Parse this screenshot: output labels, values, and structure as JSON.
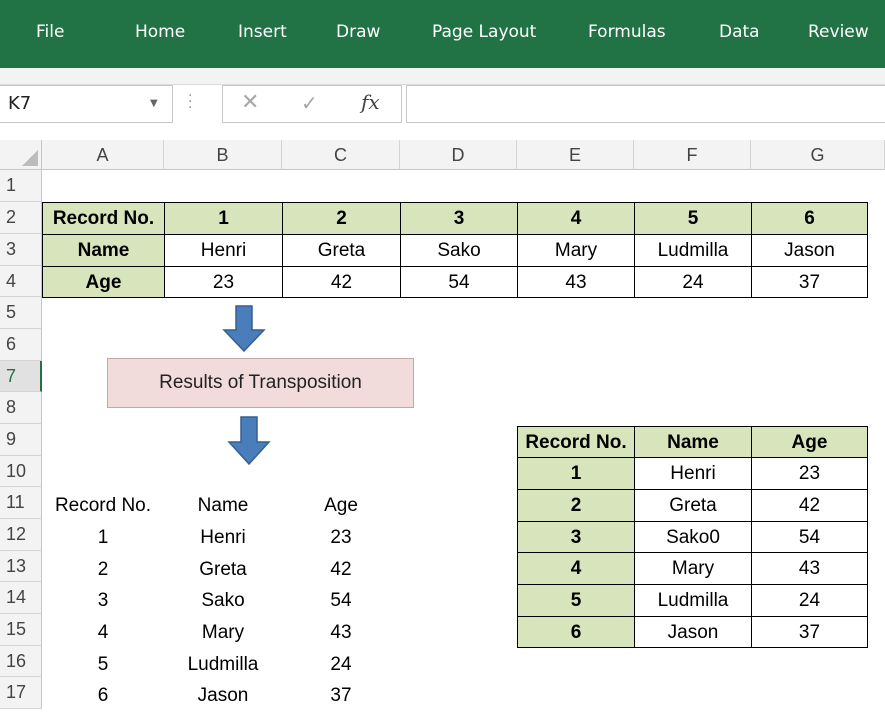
{
  "ribbon": {
    "tabs": [
      "File",
      "Home",
      "Insert",
      "Draw",
      "Page Layout",
      "Formulas",
      "Data",
      "Review"
    ],
    "color": "#217346"
  },
  "formula_bar": {
    "name_box": "K7",
    "cancel_icon": "close-icon",
    "enter_icon": "check-icon",
    "fx_label": "fx",
    "formula": ""
  },
  "sheet": {
    "columns": [
      "A",
      "B",
      "C",
      "D",
      "E",
      "F",
      "G"
    ],
    "rows": [
      "1",
      "2",
      "3",
      "4",
      "5",
      "6",
      "7",
      "8",
      "9",
      "10",
      "11",
      "12",
      "13",
      "14",
      "15",
      "16",
      "17"
    ],
    "selected_row": "7",
    "header_fill": "#d8e4bc"
  },
  "source_table": {
    "header_labels": [
      "Record No.",
      "Name",
      "Age"
    ],
    "record_nos": [
      "1",
      "2",
      "3",
      "4",
      "5",
      "6"
    ],
    "names": [
      "Henri",
      "Greta",
      "Sako",
      "Mary",
      "Ludmilla",
      "Jason"
    ],
    "ages": [
      "23",
      "42",
      "54",
      "43",
      "24",
      "37"
    ]
  },
  "results_label": "Results of Transposition",
  "result_plain": {
    "headers": [
      "Record No.",
      "Name",
      "Age"
    ],
    "rows": [
      [
        "1",
        "Henri",
        "23"
      ],
      [
        "2",
        "Greta",
        "42"
      ],
      [
        "3",
        "Sako",
        "54"
      ],
      [
        "4",
        "Mary",
        "43"
      ],
      [
        "5",
        "Ludmilla",
        "24"
      ],
      [
        "6",
        "Jason",
        "37"
      ]
    ]
  },
  "result_table": {
    "headers": [
      "Record No.",
      "Name",
      "Age"
    ],
    "rows": [
      [
        "1",
        "Henri",
        "23"
      ],
      [
        "2",
        "Greta",
        "42"
      ],
      [
        "3",
        "Sako0",
        "54"
      ],
      [
        "4",
        "Mary",
        "43"
      ],
      [
        "5",
        "Ludmilla",
        "24"
      ],
      [
        "6",
        "Jason",
        "37"
      ]
    ]
  },
  "arrow_color": "#4a7ebb"
}
